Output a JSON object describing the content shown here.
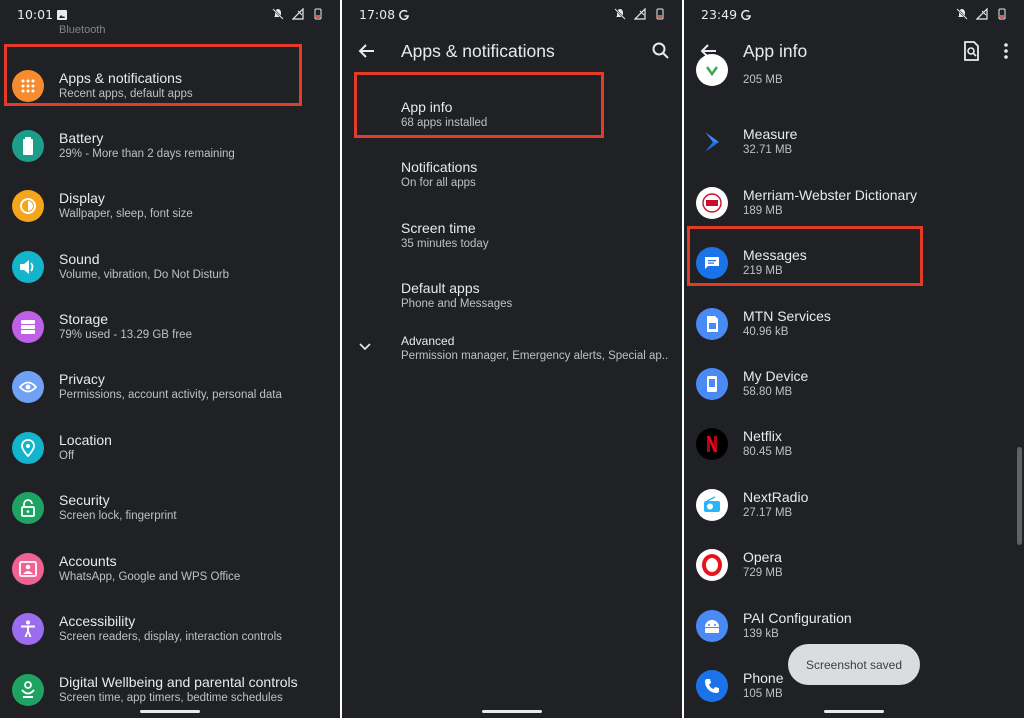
{
  "panel1": {
    "status": {
      "time": "10:01"
    },
    "partial_item": "Bluetooth",
    "items": [
      {
        "title": "Apps & notifications",
        "sub": "Recent apps, default apps",
        "color": "#f68c2d",
        "icon": "apps-grid-icon"
      },
      {
        "title": "Battery",
        "sub": "29% - More than 2 days remaining",
        "color": "#1e9e8a",
        "icon": "battery-icon"
      },
      {
        "title": "Display",
        "sub": "Wallpaper, sleep, font size",
        "color": "#f4a51c",
        "icon": "brightness-icon"
      },
      {
        "title": "Sound",
        "sub": "Volume, vibration, Do Not Disturb",
        "color": "#12b5cb",
        "icon": "volume-icon"
      },
      {
        "title": "Storage",
        "sub": "79% used - 13.29 GB free",
        "color": "#c060e6",
        "icon": "storage-icon"
      },
      {
        "title": "Privacy",
        "sub": "Permissions, account activity, personal data",
        "color": "#6fa1f5",
        "icon": "privacy-eye-icon"
      },
      {
        "title": "Location",
        "sub": "Off",
        "color": "#12b5cb",
        "icon": "location-pin-icon"
      },
      {
        "title": "Security",
        "sub": "Screen lock, fingerprint",
        "color": "#1ea362",
        "icon": "lock-icon"
      },
      {
        "title": "Accounts",
        "sub": "WhatsApp, Google and WPS Office",
        "color": "#f06292",
        "icon": "account-icon"
      },
      {
        "title": "Accessibility",
        "sub": "Screen readers, display, interaction controls",
        "color": "#9b6cf0",
        "icon": "accessibility-icon"
      },
      {
        "title": "Digital Wellbeing and parental controls",
        "sub": "Screen time, app timers, bedtime schedules",
        "color": "#1ea362",
        "icon": "wellbeing-icon"
      }
    ]
  },
  "panel2": {
    "status": {
      "time": "17:08"
    },
    "title": "Apps & notifications",
    "items": [
      {
        "title": "App info",
        "sub": "68 apps installed"
      },
      {
        "title": "Notifications",
        "sub": "On for all apps"
      },
      {
        "title": "Screen time",
        "sub": "35 minutes today"
      },
      {
        "title": "Default apps",
        "sub": "Phone and Messages"
      },
      {
        "title": "Advanced",
        "sub": "Permission manager, Emergency alerts, Special ap.."
      }
    ]
  },
  "panel3": {
    "status": {
      "time": "23:49"
    },
    "title": "App info",
    "partial_size": "205 MB",
    "apps": [
      {
        "name": "Measure",
        "size": "32.71 MB",
        "icon": "measure-icon"
      },
      {
        "name": "Merriam-Webster Dictionary",
        "size": "189 MB",
        "icon": "merriam-webster-icon"
      },
      {
        "name": "Messages",
        "size": "219 MB",
        "icon": "messages-icon"
      },
      {
        "name": "MTN Services",
        "size": "40.96 kB",
        "icon": "sim-card-icon"
      },
      {
        "name": "My Device",
        "size": "58.80 MB",
        "icon": "device-icon"
      },
      {
        "name": "Netflix",
        "size": "80.45 MB",
        "icon": "netflix-icon"
      },
      {
        "name": "NextRadio",
        "size": "27.17 MB",
        "icon": "radio-icon"
      },
      {
        "name": "Opera",
        "size": "729 MB",
        "icon": "opera-icon"
      },
      {
        "name": "PAI Configuration",
        "size": "139 kB",
        "icon": "android-icon"
      },
      {
        "name": "Phone",
        "size": "105 MB",
        "icon": "phone-icon"
      }
    ],
    "toast": "Screenshot saved"
  }
}
